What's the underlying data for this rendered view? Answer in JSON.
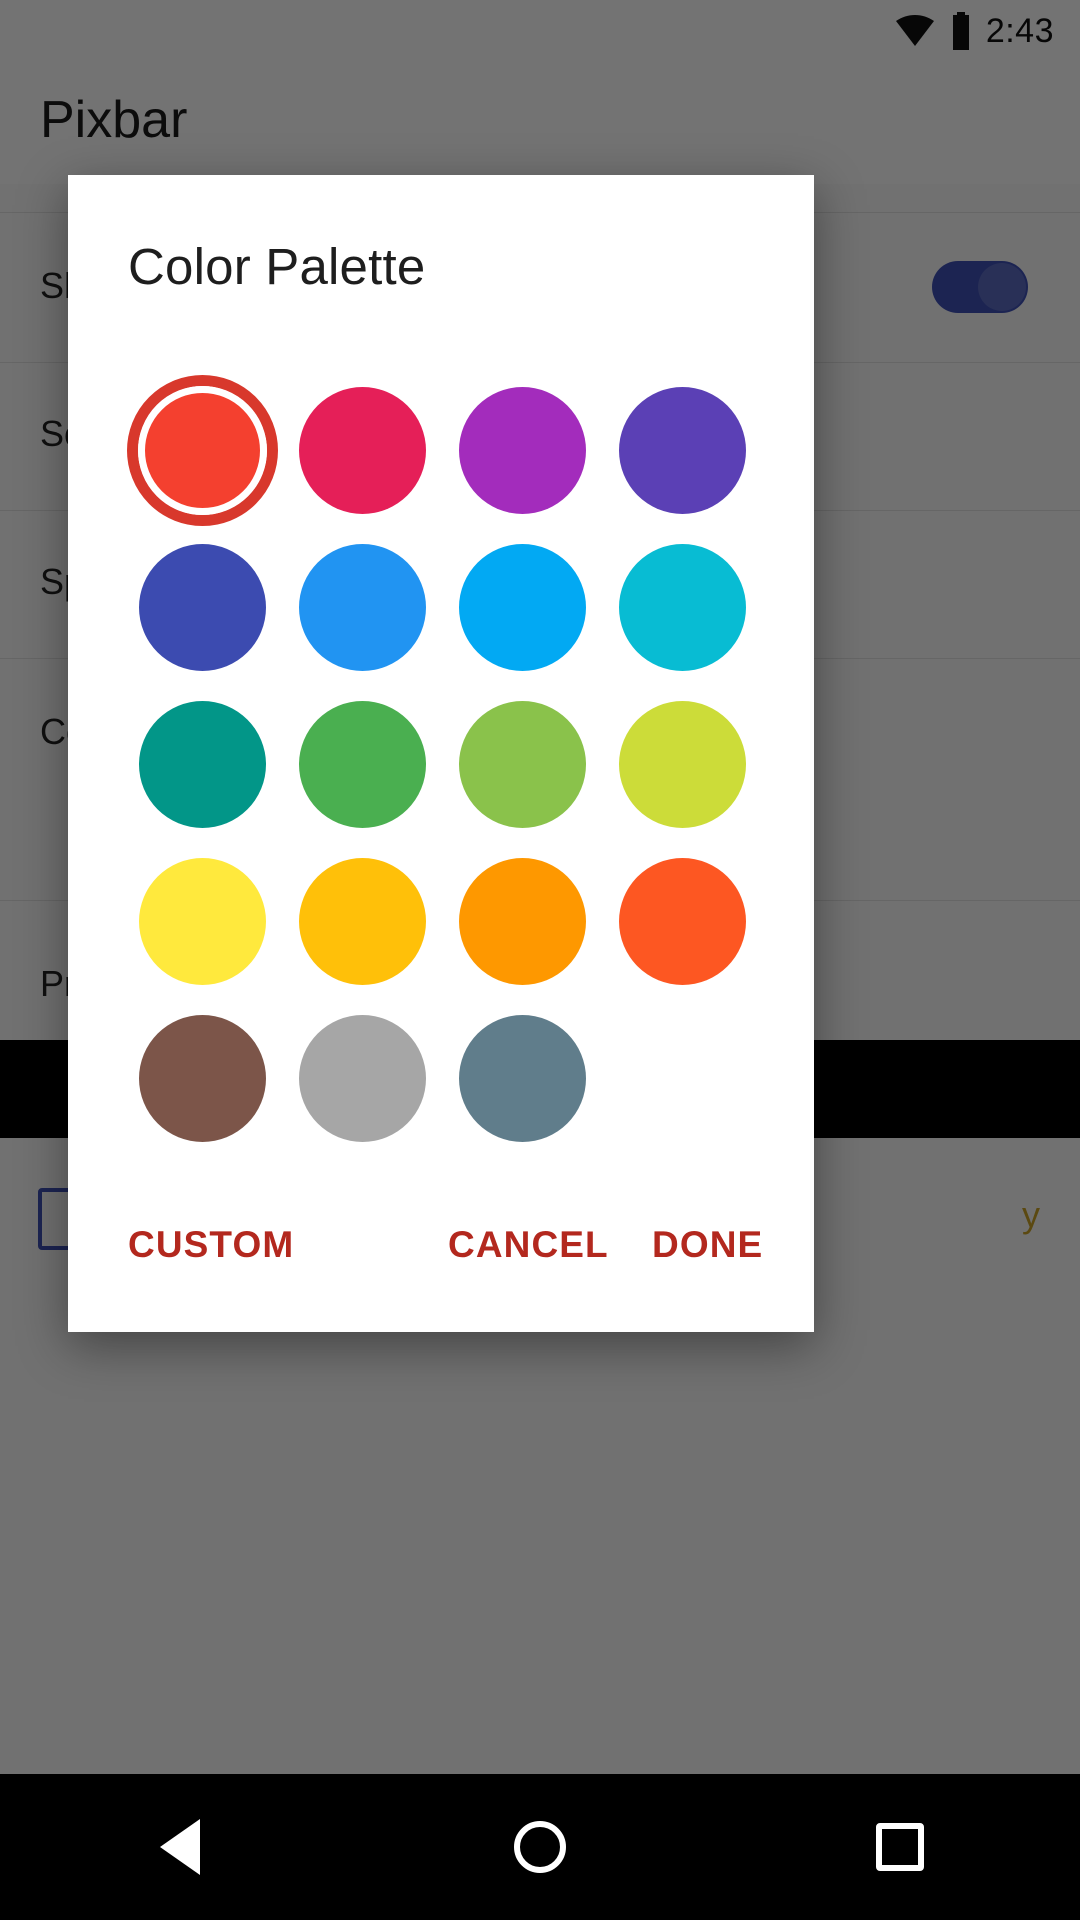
{
  "status_bar": {
    "time": "2:43",
    "icons": [
      "wifi-icon",
      "battery-icon"
    ]
  },
  "background_app": {
    "title": "Pixbar",
    "rows": [
      {
        "label": "Show status bar",
        "sub": "",
        "has_toggle": true
      },
      {
        "label": "Source",
        "sub": ""
      },
      {
        "label": "Speed",
        "sub": ""
      },
      {
        "label": "Color",
        "sub": ""
      },
      {
        "label": "Preview",
        "sub": ""
      }
    ],
    "bottom_link": "y",
    "accent": "#3f51b5"
  },
  "dialog": {
    "title": "Color Palette",
    "selected_index": 0,
    "selection_ring_color": "#d8382c",
    "swatch_rows": [
      [
        {
          "name": "red",
          "hex": "#f4402f"
        },
        {
          "name": "pink",
          "hex": "#e51f58"
        },
        {
          "name": "purple",
          "hex": "#a32cbc"
        },
        {
          "name": "deep-purple",
          "hex": "#5b40b5"
        }
      ],
      [
        {
          "name": "indigo",
          "hex": "#3c4bb0"
        },
        {
          "name": "blue",
          "hex": "#2194f2"
        },
        {
          "name": "light-blue",
          "hex": "#02a9f3"
        },
        {
          "name": "cyan",
          "hex": "#08bcd3"
        }
      ],
      [
        {
          "name": "teal",
          "hex": "#029688"
        },
        {
          "name": "green",
          "hex": "#4aaf50"
        },
        {
          "name": "light-green",
          "hex": "#8ac24b"
        },
        {
          "name": "lime",
          "hex": "#ccdc39"
        }
      ],
      [
        {
          "name": "yellow",
          "hex": "#ffe93d"
        },
        {
          "name": "amber",
          "hex": "#ffc009"
        },
        {
          "name": "orange",
          "hex": "#fe9800"
        },
        {
          "name": "deep-orange",
          "hex": "#fd5722"
        }
      ],
      [
        {
          "name": "brown",
          "hex": "#7c5549"
        },
        {
          "name": "grey",
          "hex": "#a6a6a6"
        },
        {
          "name": "blue-grey",
          "hex": "#607d8b"
        }
      ]
    ],
    "buttons": {
      "custom": "CUSTOM",
      "cancel": "CANCEL",
      "done": "DONE",
      "color": "#b3281e"
    }
  },
  "nav_bar": {
    "back": "back-icon",
    "home": "home-icon",
    "recents": "recents-icon"
  }
}
